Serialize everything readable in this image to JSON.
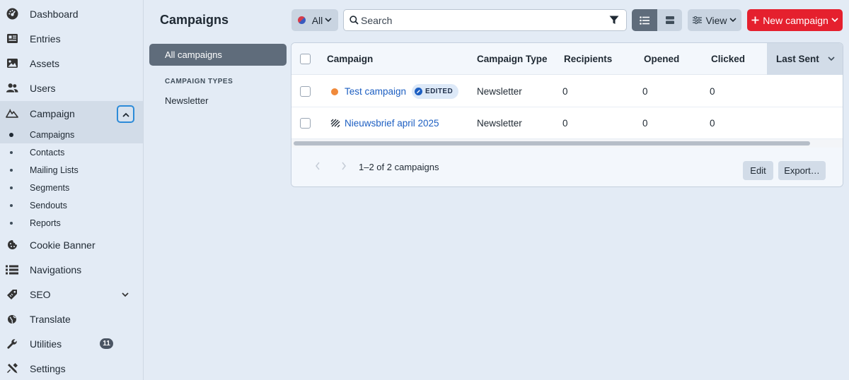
{
  "sidebar": {
    "items": [
      {
        "label": "Dashboard",
        "icon": "dashboard-gauge-icon"
      },
      {
        "label": "Entries",
        "icon": "newspaper-icon"
      },
      {
        "label": "Assets",
        "icon": "image-icon"
      },
      {
        "label": "Users",
        "icon": "users-icon"
      },
      {
        "label": "Campaign",
        "icon": "campaign-mountain-icon"
      },
      {
        "label": "Cookie Banner",
        "icon": "cookie-icon"
      },
      {
        "label": "Navigations",
        "icon": "list-icon"
      },
      {
        "label": "SEO",
        "icon": "tag-icon"
      },
      {
        "label": "Translate",
        "icon": "globe-icon"
      },
      {
        "label": "Utilities",
        "icon": "wrench-icon",
        "badge": "11"
      },
      {
        "label": "Settings",
        "icon": "settings-tools-icon"
      }
    ],
    "campaign_subitems": [
      "Campaigns",
      "Contacts",
      "Mailing Lists",
      "Segments",
      "Sendouts",
      "Reports"
    ]
  },
  "header": {
    "title": "Campaigns",
    "site_label": "All",
    "search_placeholder": "Search",
    "view_label": "View",
    "new_label": "New campaign"
  },
  "sources": {
    "all": "All campaigns",
    "types_heading": "CAMPAIGN TYPES",
    "types": [
      "Newsletter"
    ]
  },
  "table": {
    "columns": [
      "Campaign",
      "Campaign Type",
      "Recipients",
      "Opened",
      "Clicked",
      "Last Sent"
    ],
    "rows": [
      {
        "title": "Test campaign",
        "badge": "EDITED",
        "type": "Newsletter",
        "recipients": "0",
        "opened": "0",
        "clicked": "0",
        "last_sent": ""
      },
      {
        "title": "Nieuwsbrief april 2025",
        "type": "Newsletter",
        "recipients": "0",
        "opened": "0",
        "clicked": "0",
        "last_sent": ""
      }
    ]
  },
  "footer": {
    "pagination": "1–2 of 2 campaigns",
    "edit_label": "Edit",
    "export_label": "Export…"
  },
  "colors": {
    "accent": "#e5202e",
    "link": "#1d5fc2",
    "status_draft": "#f08a3b",
    "focus": "#2d8bd8"
  }
}
